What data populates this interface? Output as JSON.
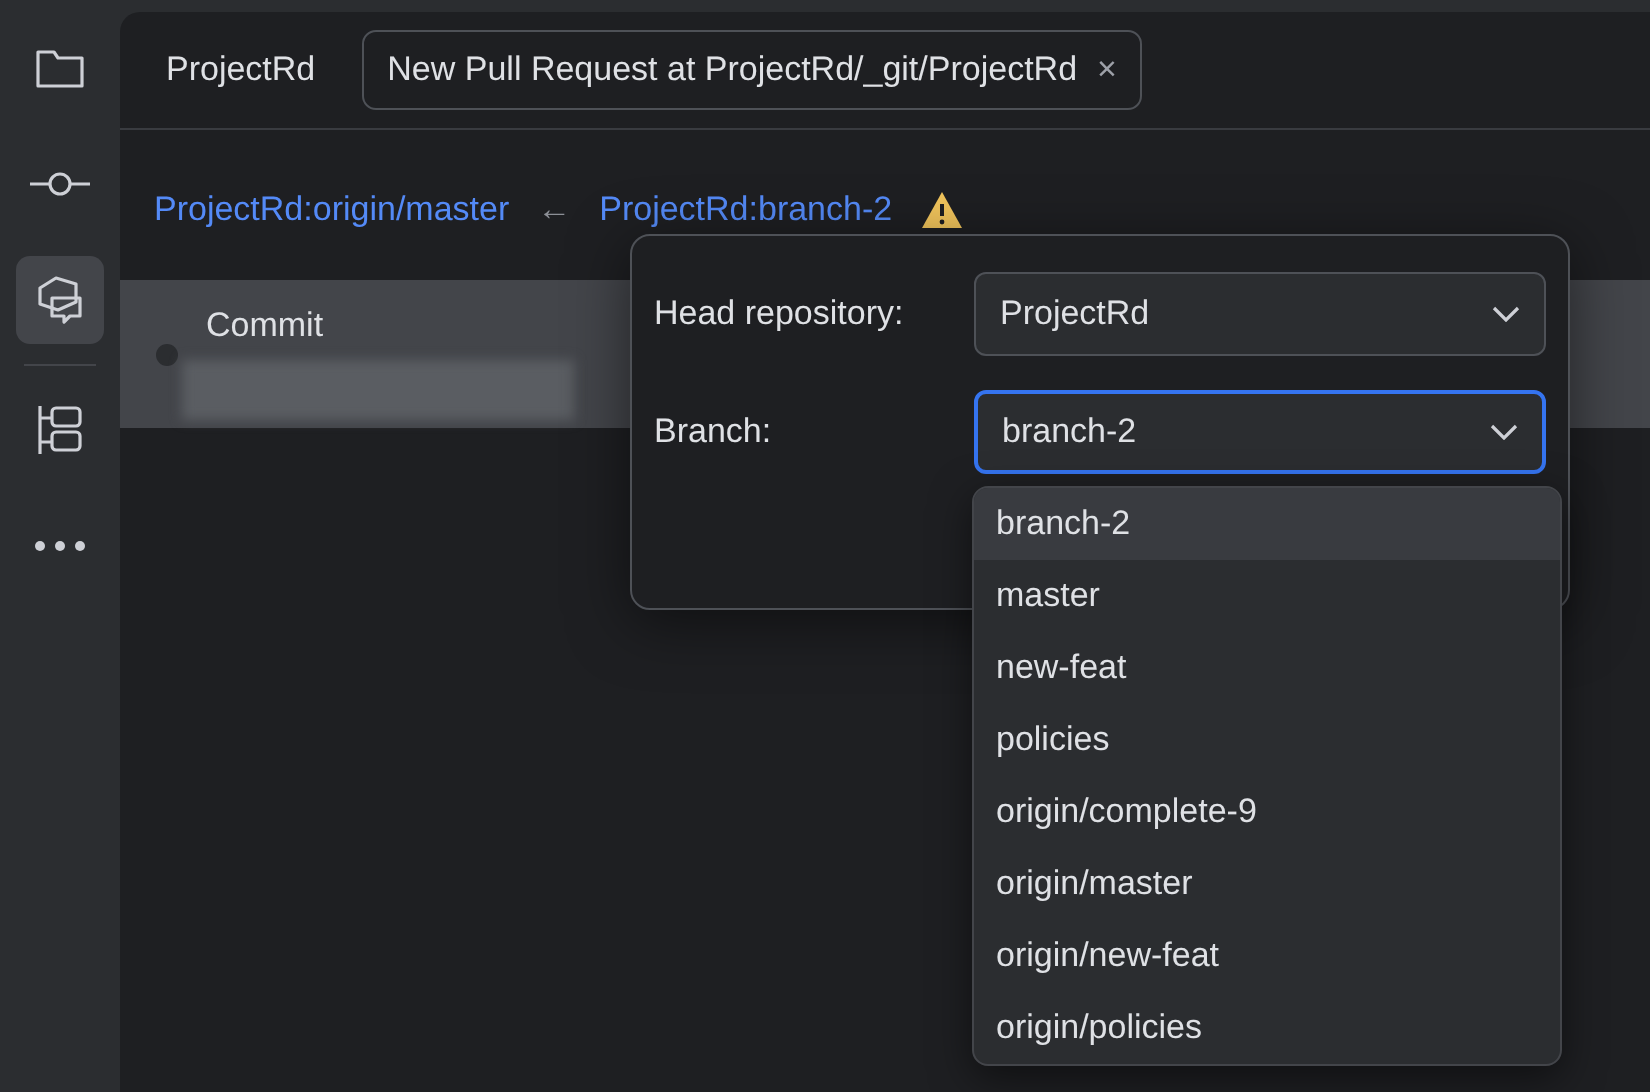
{
  "sidebar": {
    "items": [
      {
        "selected": false
      },
      {
        "selected": false
      },
      {
        "selected": true
      },
      {
        "selected": false
      },
      {
        "selected": false
      }
    ]
  },
  "tabs": [
    {
      "label": "ProjectRd",
      "selected": false
    },
    {
      "label": "New Pull Request at ProjectRd/_git/ProjectRd",
      "selected": true,
      "close": "×"
    }
  ],
  "header": {
    "base": "ProjectRd:origin/master",
    "arrow": "←",
    "head": "ProjectRd:branch-2",
    "warning": true
  },
  "commits": [
    {
      "title": "Commit",
      "selected": true
    }
  ],
  "popup": {
    "fields": [
      {
        "label": "Head repository:",
        "value": "ProjectRd",
        "focused": false
      },
      {
        "label": "Branch:",
        "value": "branch-2",
        "focused": true
      }
    ],
    "options": [
      {
        "label": "branch-2",
        "selected": true
      },
      {
        "label": "master",
        "selected": false
      },
      {
        "label": "new-feat",
        "selected": false
      },
      {
        "label": "policies",
        "selected": false
      },
      {
        "label": "origin/complete-9",
        "selected": false
      },
      {
        "label": "origin/master",
        "selected": false
      },
      {
        "label": "origin/new-feat",
        "selected": false
      },
      {
        "label": "origin/policies",
        "selected": false
      }
    ]
  }
}
